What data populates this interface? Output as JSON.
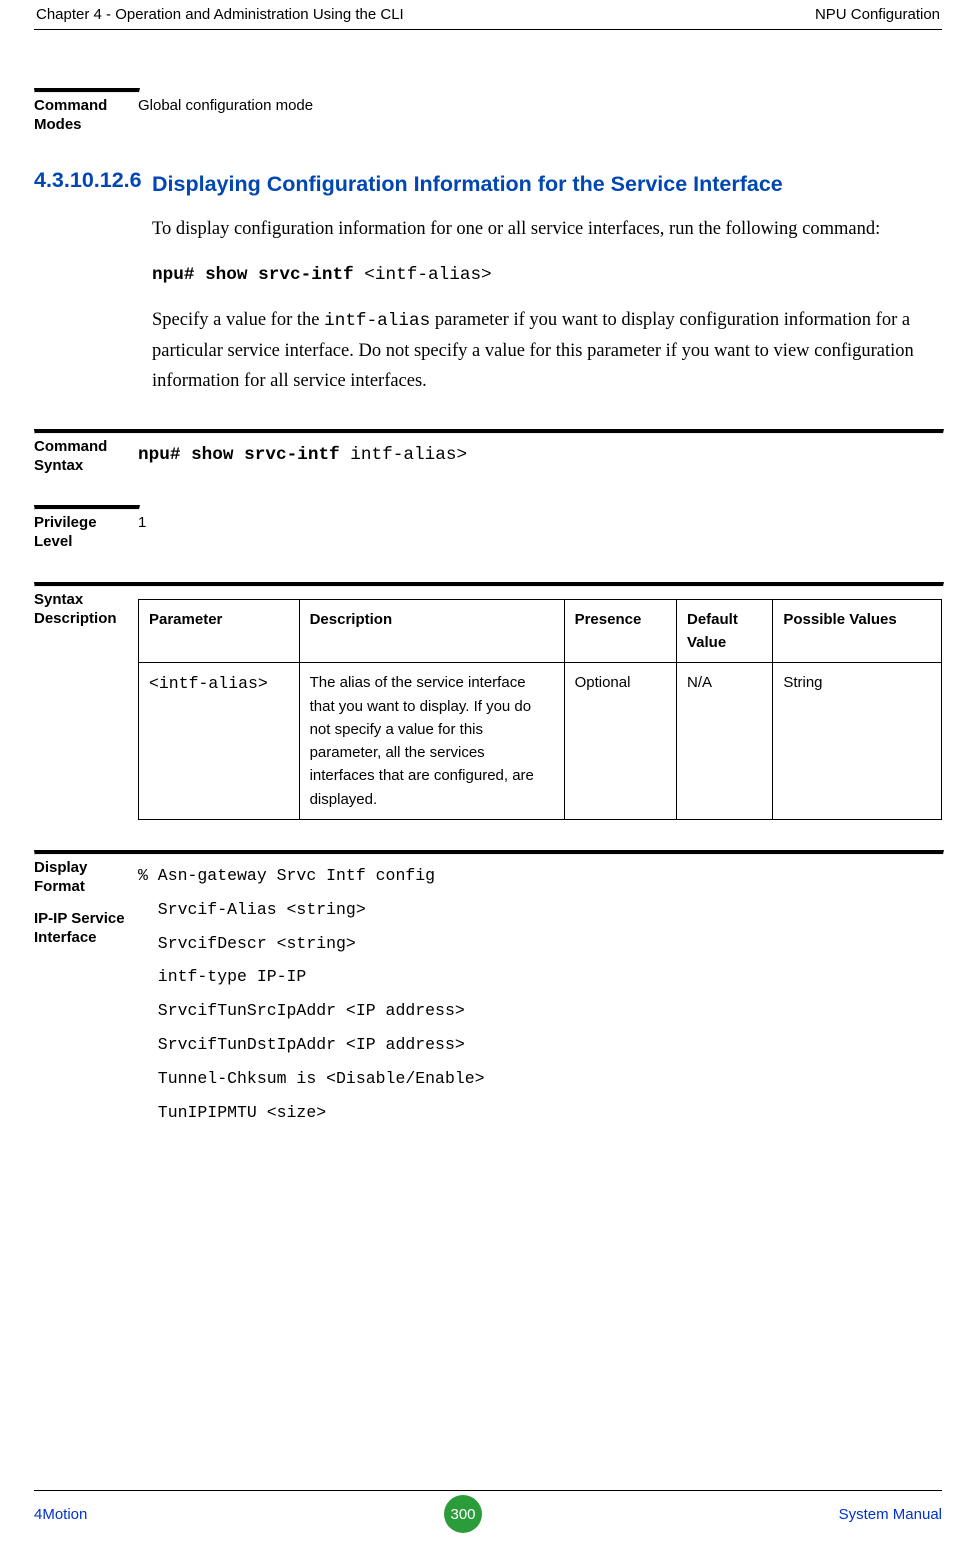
{
  "header": {
    "left": "Chapter 4 - Operation and Administration Using the CLI",
    "right": "NPU Configuration"
  },
  "command_modes": {
    "label": "Command Modes",
    "value": "Global configuration mode"
  },
  "section_4_3_10_12_6": {
    "number": "4.3.10.12.6",
    "title": "Displaying Configuration Information for the Service Interface",
    "para1": " To display configuration information for one or all service interfaces, run the following command:",
    "cmd_bold": "npu# show srvc-intf ",
    "cmd_arg": "<intf-alias>",
    "para2_pre": "Specify a value for the ",
    "para2_mono": "intf-alias",
    "para2_post": " parameter if you want to display configuration information for a particular service interface. Do not specify a value for this parameter if you want to view configuration information for all service interfaces."
  },
  "command_syntax": {
    "label": "Command Syntax",
    "bold": "npu# show srvc-intf ",
    "rest": "intf-alias>"
  },
  "privilege_level": {
    "label": "Privilege Level",
    "value": "1"
  },
  "syntax_description": {
    "label": "Syntax Description",
    "headers": {
      "parameter": "Parameter",
      "description": "Description",
      "presence": "Presence",
      "default_value": "Default Value",
      "possible_values": "Possible Values"
    },
    "row": {
      "parameter": "<intf-alias>",
      "description": "The alias  of the service interface that you want to display. If you do not specify a value for this parameter, all the services interfaces that are configured, are displayed.",
      "presence": "Optional",
      "default_value": "N/A",
      "possible_values": "String"
    }
  },
  "display_format": {
    "label": "Display Format",
    "sublabel": "IP-IP Service Interface",
    "lines": [
      "% Asn-gateway Srvc Intf config",
      "  Srvcif-Alias <string>",
      "  SrvcifDescr <string>",
      "  intf-type IP-IP",
      "  SrvcifTunSrcIpAddr <IP address>",
      "  SrvcifTunDstIpAddr <IP address>",
      "  Tunnel-Chksum is <Disable/Enable>",
      "  TunIPIPMTU <size>"
    ]
  },
  "footer": {
    "left": "4Motion",
    "page": "300",
    "right": "System Manual"
  }
}
